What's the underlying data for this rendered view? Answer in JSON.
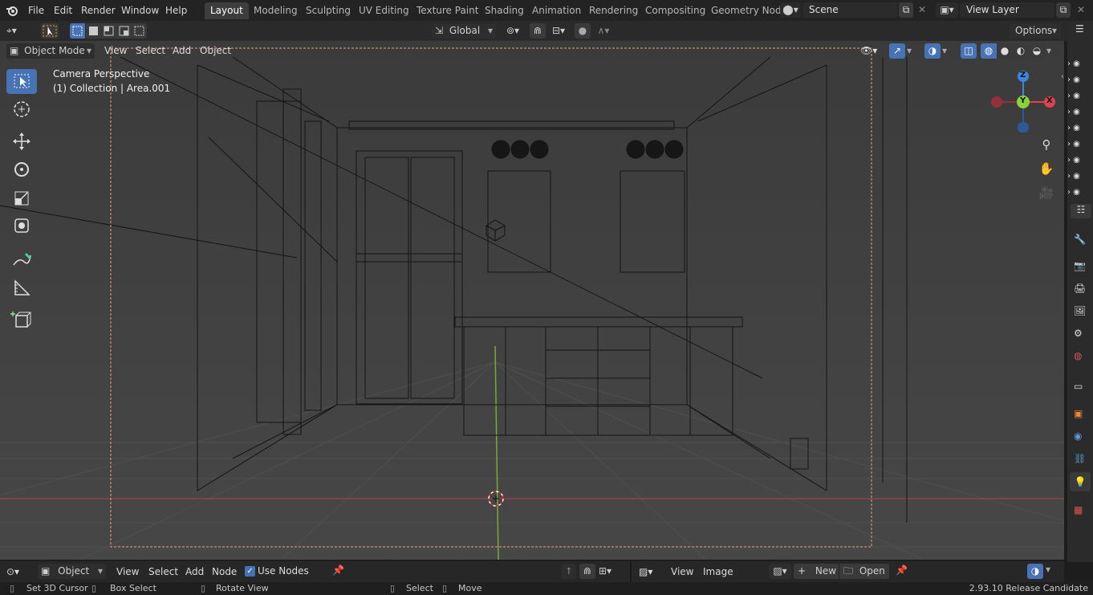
{
  "menu": {
    "file": "File",
    "edit": "Edit",
    "render": "Render",
    "window": "Window",
    "help": "Help"
  },
  "workspaces": [
    "Layout",
    "Modeling",
    "Sculpting",
    "UV Editing",
    "Texture Paint",
    "Shading",
    "Animation",
    "Rendering",
    "Compositing",
    "Geometry Nod"
  ],
  "scene": {
    "name": "Scene"
  },
  "view_layer": {
    "name": "View Layer"
  },
  "tool_header": {
    "orientation": "Global",
    "options": "Options"
  },
  "viewport_header": {
    "mode": "Object Mode",
    "view": "View",
    "select": "Select",
    "add": "Add",
    "object": "Object"
  },
  "overlay_text": {
    "camera": "Camera Perspective",
    "collection": "(1) Collection | Area.001"
  },
  "gizmo": {
    "z": "Z",
    "y": "Y",
    "x": "X"
  },
  "node_header": {
    "type": "Object",
    "view": "View",
    "select": "Select",
    "add": "Add",
    "node": "Node",
    "use_nodes": "Use Nodes"
  },
  "image_header": {
    "view": "View",
    "image": "Image",
    "new": "New",
    "open": "Open"
  },
  "status": {
    "cursor": "Set 3D Cursor",
    "box": "Box Select",
    "rotate": "Rotate View",
    "select": "Select",
    "move": "Move",
    "version": "2.93.10 Release Candidate"
  },
  "colors": {
    "accent": "#4772b3",
    "x_axis": "#e0414f",
    "y_axis": "#8ad23a",
    "z_axis": "#3c86e0"
  }
}
